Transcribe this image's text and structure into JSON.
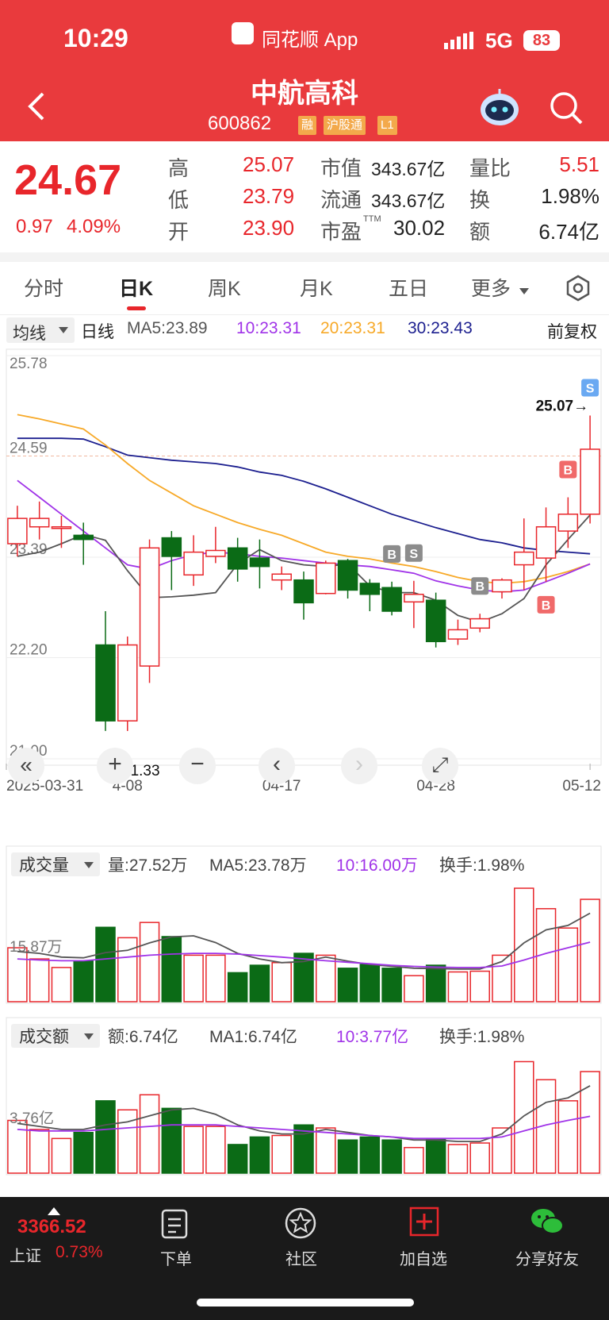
{
  "status": {
    "time": "10:29",
    "app_name": "同花顺 App",
    "network": "5G",
    "battery": "83"
  },
  "header": {
    "name": "中航高科",
    "code": "600862",
    "tags": [
      "融",
      "沪股通",
      "L1"
    ]
  },
  "quote": {
    "price": "24.67",
    "change": "0.97",
    "change_pct": "4.09%",
    "high_label": "高",
    "high": "25.07",
    "low_label": "低",
    "low": "23.79",
    "open_label": "开",
    "open": "23.90",
    "mktcap_label": "市值",
    "mktcap": "343.67亿",
    "float_label": "流通",
    "float": "343.67亿",
    "pe_label": "市盈",
    "pe_sup": "TTM",
    "pe": "30.02",
    "vr_label": "量比",
    "vr": "5.51",
    "turnover_label": "换",
    "turnover": "1.98%",
    "amount_label": "额",
    "amount": "6.74亿"
  },
  "tabs": [
    "分时",
    "日K",
    "周K",
    "月K",
    "五日",
    "更多"
  ],
  "active_tab": "日K",
  "ma_bar": {
    "selector": "均线",
    "period": "日线",
    "ma5": "MA5:23.89",
    "ma10": "10:23.31",
    "ma20": "20:23.31",
    "ma30": "30:23.43",
    "adjust": "前复权"
  },
  "colors": {
    "up": "#e8262b",
    "down": "#0b6b16",
    "ma5": "#555555",
    "ma10": "#a033e8",
    "ma20": "#f7a928",
    "ma30": "#1c1f8f",
    "header": "#e93a3d"
  },
  "chart_data": [
    {
      "type": "candlestick",
      "ylim": [
        21.0,
        25.78
      ],
      "y_ticks": [
        "25.78",
        "24.59",
        "23.39",
        "22.20",
        "21.00"
      ],
      "x_ticks": [
        "2025-03-31",
        "4-08",
        "04-17",
        "04-28",
        "05-12"
      ],
      "annot_high": "25.07→",
      "annot_low": "←21.33",
      "markers": [
        "B",
        "S",
        "B",
        "B",
        "B",
        "S"
      ],
      "candles": [
        {
          "o": 23.55,
          "c": 23.85,
          "h": 24.0,
          "l": 23.4
        },
        {
          "o": 23.75,
          "c": 23.85,
          "h": 24.05,
          "l": 23.6
        },
        {
          "o": 23.75,
          "c": 23.75,
          "h": 23.88,
          "l": 23.5
        },
        {
          "o": 23.65,
          "c": 23.6,
          "h": 23.8,
          "l": 23.3
        },
        {
          "o": 22.35,
          "c": 21.45,
          "h": 22.75,
          "l": 21.33
        },
        {
          "o": 21.45,
          "c": 22.35,
          "h": 22.45,
          "l": 21.33
        },
        {
          "o": 22.1,
          "c": 23.5,
          "h": 23.6,
          "l": 21.9
        },
        {
          "o": 23.62,
          "c": 23.4,
          "h": 23.7,
          "l": 23.0
        },
        {
          "o": 23.18,
          "c": 23.45,
          "h": 23.65,
          "l": 23.05
        },
        {
          "o": 23.4,
          "c": 23.47,
          "h": 23.75,
          "l": 23.32
        },
        {
          "o": 23.5,
          "c": 23.25,
          "h": 23.62,
          "l": 23.1
        },
        {
          "o": 23.38,
          "c": 23.28,
          "h": 23.6,
          "l": 23.02
        },
        {
          "o": 23.12,
          "c": 23.19,
          "h": 23.28,
          "l": 23.0
        },
        {
          "o": 23.12,
          "c": 22.85,
          "h": 23.22,
          "l": 22.65
        },
        {
          "o": 22.96,
          "c": 23.32,
          "h": 23.35,
          "l": 22.95
        },
        {
          "o": 23.35,
          "c": 23.0,
          "h": 23.37,
          "l": 22.9
        },
        {
          "o": 23.08,
          "c": 22.95,
          "h": 23.13,
          "l": 22.75
        },
        {
          "o": 23.03,
          "c": 22.75,
          "h": 23.1,
          "l": 22.7
        },
        {
          "o": 22.86,
          "c": 22.95,
          "h": 23.11,
          "l": 22.55
        },
        {
          "o": 22.88,
          "c": 22.39,
          "h": 22.97,
          "l": 22.32
        },
        {
          "o": 22.42,
          "c": 22.53,
          "h": 22.65,
          "l": 22.35
        },
        {
          "o": 22.55,
          "c": 22.66,
          "h": 22.72,
          "l": 22.5
        },
        {
          "o": 22.98,
          "c": 23.12,
          "h": 23.14,
          "l": 22.9
        },
        {
          "o": 23.3,
          "c": 23.45,
          "h": 23.85,
          "l": 23.0
        },
        {
          "o": 23.38,
          "c": 23.75,
          "h": 23.98,
          "l": 23.1
        },
        {
          "o": 23.7,
          "c": 23.9,
          "h": 24.1,
          "l": 23.5
        },
        {
          "o": 23.9,
          "c": 24.67,
          "h": 25.07,
          "l": 23.79
        }
      ],
      "ma5": [
        23.4,
        23.45,
        23.55,
        23.66,
        23.59,
        23.23,
        22.91,
        22.92,
        22.94,
        22.97,
        23.31,
        23.48,
        23.35,
        23.3,
        23.28,
        23.31,
        23.05,
        22.97,
        22.97,
        22.88,
        22.7,
        22.62,
        22.72,
        22.9,
        23.3,
        23.6,
        23.89
      ],
      "ma10": [
        24.3,
        24.1,
        23.9,
        23.7,
        23.5,
        23.3,
        23.25,
        23.35,
        23.42,
        23.45,
        23.43,
        23.4,
        23.38,
        23.35,
        23.32,
        23.3,
        23.28,
        23.24,
        23.2,
        23.11,
        23.05,
        23.0,
        22.98,
        23.0,
        23.1,
        23.2,
        23.31
      ],
      "ma20": [
        25.08,
        25.03,
        24.97,
        24.91,
        24.72,
        24.5,
        24.3,
        24.15,
        24.0,
        23.9,
        23.8,
        23.72,
        23.65,
        23.55,
        23.45,
        23.4,
        23.37,
        23.32,
        23.28,
        23.22,
        23.15,
        23.1,
        23.08,
        23.1,
        23.15,
        23.22,
        23.31
      ],
      "ma30": [
        24.8,
        24.8,
        24.8,
        24.79,
        24.7,
        24.6,
        24.57,
        24.54,
        24.52,
        24.5,
        24.46,
        24.4,
        24.36,
        24.29,
        24.2,
        24.1,
        24.0,
        23.9,
        23.82,
        23.74,
        23.67,
        23.6,
        23.56,
        23.5,
        23.47,
        23.45,
        23.43
      ]
    },
    {
      "type": "bar",
      "panel": "volume",
      "selector": "成交量",
      "info": [
        "量:27.52万",
        "MA5:23.78万",
        "10:16.00万",
        "换手:1.98%"
      ],
      "y_tick": "15.87万",
      "ylim": [
        0,
        32
      ],
      "values": [
        14.5,
        11.5,
        9.2,
        11.0,
        20.0,
        17.2,
        21.3,
        17.5,
        12.5,
        12.5,
        7.8,
        9.8,
        10.5,
        13.0,
        12.5,
        9.0,
        10.0,
        9.0,
        7.0,
        9.8,
        8.0,
        8.2,
        12.5,
        30.5,
        25.0,
        19.8,
        27.52
      ],
      "ma5": [
        13.5,
        13.0,
        12.0,
        11.8,
        13.2,
        13.8,
        15.8,
        17.4,
        17.7,
        15.9,
        13.0,
        11.5,
        10.5,
        10.8,
        12.0,
        10.9,
        10.0,
        9.5,
        9.0,
        8.9,
        8.8,
        8.8,
        10.8,
        15.8,
        19.3,
        20.5,
        23.78
      ],
      "ma10": [
        11.5,
        11.2,
        11.0,
        11.0,
        11.5,
        12.0,
        12.5,
        12.8,
        13.0,
        13.0,
        12.8,
        12.4,
        12.0,
        11.5,
        11.0,
        10.6,
        10.2,
        9.8,
        9.5,
        9.3,
        9.2,
        9.2,
        9.6,
        11.2,
        13.0,
        14.5,
        16.0
      ]
    },
    {
      "type": "bar",
      "panel": "amount",
      "selector": "成交额",
      "info": [
        "额:6.74亿",
        "MA1:6.74亿",
        "10:3.77亿",
        "换手:1.98%"
      ],
      "y_tick": "3.76亿",
      "ylim": [
        0,
        7.9
      ],
      "values": [
        3.5,
        2.9,
        2.3,
        2.7,
        4.8,
        4.2,
        5.2,
        4.3,
        3.1,
        3.1,
        1.9,
        2.4,
        2.5,
        3.2,
        3.0,
        2.2,
        2.4,
        2.2,
        1.7,
        2.3,
        1.9,
        2.0,
        3.0,
        7.4,
        6.2,
        4.8,
        6.74
      ],
      "ma5": [
        3.3,
        3.1,
        2.9,
        2.9,
        3.2,
        3.4,
        3.8,
        4.2,
        4.3,
        3.9,
        3.2,
        2.8,
        2.6,
        2.6,
        2.9,
        2.7,
        2.5,
        2.4,
        2.2,
        2.2,
        2.1,
        2.1,
        2.6,
        3.8,
        4.7,
        5.0,
        5.8
      ],
      "ma10": [
        2.9,
        2.8,
        2.8,
        2.8,
        2.9,
        3.0,
        3.1,
        3.2,
        3.2,
        3.2,
        3.1,
        3.0,
        2.9,
        2.8,
        2.7,
        2.6,
        2.5,
        2.4,
        2.3,
        2.3,
        2.3,
        2.3,
        2.4,
        2.8,
        3.2,
        3.5,
        3.77
      ]
    }
  ],
  "controls": [
    "«",
    "+",
    "−",
    "‹",
    "›",
    "⤢"
  ],
  "bottom_nav": {
    "index_value": "3366.52",
    "index_name": "上证",
    "index_pct": "0.73%",
    "items": [
      "下单",
      "社区",
      "加自选",
      "分享好友"
    ]
  }
}
